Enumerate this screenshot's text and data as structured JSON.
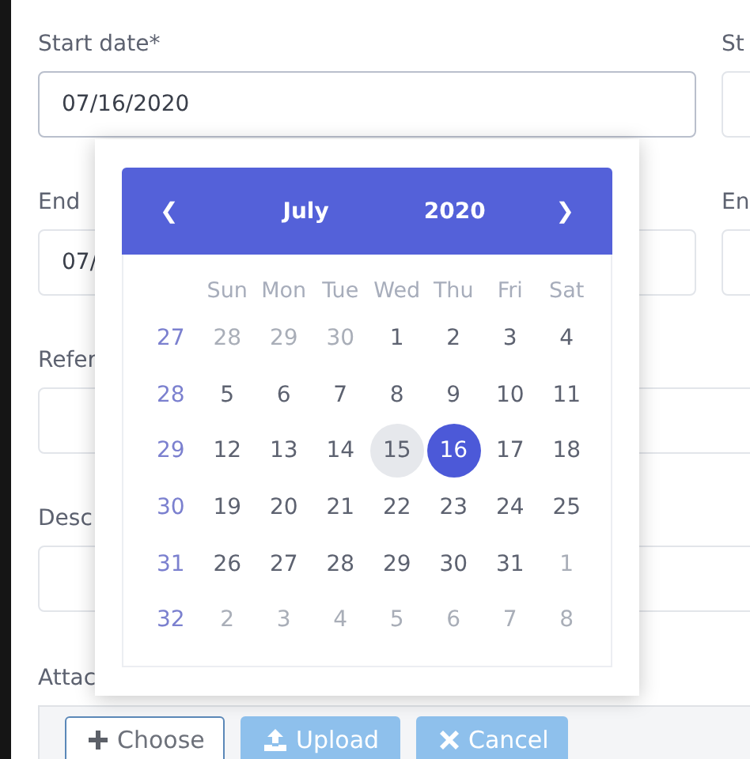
{
  "rows": [
    {
      "fields": [
        {
          "label": "Start date*",
          "value": "07/16/2020"
        },
        {
          "label": "St"
        }
      ]
    },
    {
      "fields": [
        {
          "label": "End",
          "value": "07/"
        },
        {
          "label": "En"
        }
      ]
    },
    {
      "fields": [
        {
          "label": "Refer"
        }
      ]
    },
    {
      "fields": [
        {
          "label": "Desc"
        }
      ]
    }
  ],
  "attachment": {
    "label": "Attac",
    "buttons": [
      {
        "label": "Choose",
        "kind": "choose"
      },
      {
        "label": "Upload",
        "kind": "upload"
      },
      {
        "label": "Cancel",
        "kind": "cancel"
      }
    ]
  },
  "datepicker": {
    "prev": "❮",
    "month": "July",
    "year": "2020",
    "next": "❯",
    "weekdays": [
      "Sun",
      "Mon",
      "Tue",
      "Wed",
      "Thu",
      "Fri",
      "Sat"
    ],
    "weeks": [
      {
        "number": "27",
        "days": [
          {
            "label": "28",
            "muted": true,
            "today": false,
            "selected": false
          },
          {
            "label": "29",
            "muted": true,
            "today": false,
            "selected": false
          },
          {
            "label": "30",
            "muted": true,
            "today": false,
            "selected": false
          },
          {
            "label": "1",
            "muted": false,
            "today": false,
            "selected": false
          },
          {
            "label": "2",
            "muted": false,
            "today": false,
            "selected": false
          },
          {
            "label": "3",
            "muted": false,
            "today": false,
            "selected": false
          },
          {
            "label": "4",
            "muted": false,
            "today": false,
            "selected": false
          }
        ]
      },
      {
        "number": "28",
        "days": [
          {
            "label": "5",
            "muted": false,
            "today": false,
            "selected": false
          },
          {
            "label": "6",
            "muted": false,
            "today": false,
            "selected": false
          },
          {
            "label": "7",
            "muted": false,
            "today": false,
            "selected": false
          },
          {
            "label": "8",
            "muted": false,
            "today": false,
            "selected": false
          },
          {
            "label": "9",
            "muted": false,
            "today": false,
            "selected": false
          },
          {
            "label": "10",
            "muted": false,
            "today": false,
            "selected": false
          },
          {
            "label": "11",
            "muted": false,
            "today": false,
            "selected": false
          }
        ]
      },
      {
        "number": "29",
        "days": [
          {
            "label": "12",
            "muted": false,
            "today": false,
            "selected": false
          },
          {
            "label": "13",
            "muted": false,
            "today": false,
            "selected": false
          },
          {
            "label": "14",
            "muted": false,
            "today": false,
            "selected": false
          },
          {
            "label": "15",
            "muted": false,
            "today": true,
            "selected": false
          },
          {
            "label": "16",
            "muted": false,
            "today": false,
            "selected": true
          },
          {
            "label": "17",
            "muted": false,
            "today": false,
            "selected": false
          },
          {
            "label": "18",
            "muted": false,
            "today": false,
            "selected": false
          }
        ]
      },
      {
        "number": "30",
        "days": [
          {
            "label": "19",
            "muted": false,
            "today": false,
            "selected": false
          },
          {
            "label": "20",
            "muted": false,
            "today": false,
            "selected": false
          },
          {
            "label": "21",
            "muted": false,
            "today": false,
            "selected": false
          },
          {
            "label": "22",
            "muted": false,
            "today": false,
            "selected": false
          },
          {
            "label": "23",
            "muted": false,
            "today": false,
            "selected": false
          },
          {
            "label": "24",
            "muted": false,
            "today": false,
            "selected": false
          },
          {
            "label": "25",
            "muted": false,
            "today": false,
            "selected": false
          }
        ]
      },
      {
        "number": "31",
        "days": [
          {
            "label": "26",
            "muted": false,
            "today": false,
            "selected": false
          },
          {
            "label": "27",
            "muted": false,
            "today": false,
            "selected": false
          },
          {
            "label": "28",
            "muted": false,
            "today": false,
            "selected": false
          },
          {
            "label": "29",
            "muted": false,
            "today": false,
            "selected": false
          },
          {
            "label": "30",
            "muted": false,
            "today": false,
            "selected": false
          },
          {
            "label": "31",
            "muted": false,
            "today": false,
            "selected": false
          },
          {
            "label": "1",
            "muted": true,
            "today": false,
            "selected": false
          }
        ]
      },
      {
        "number": "32",
        "days": [
          {
            "label": "2",
            "muted": true,
            "today": false,
            "selected": false
          },
          {
            "label": "3",
            "muted": true,
            "today": false,
            "selected": false
          },
          {
            "label": "4",
            "muted": true,
            "today": false,
            "selected": false
          },
          {
            "label": "5",
            "muted": true,
            "today": false,
            "selected": false
          },
          {
            "label": "6",
            "muted": true,
            "today": false,
            "selected": false
          },
          {
            "label": "7",
            "muted": true,
            "today": false,
            "selected": false
          },
          {
            "label": "8",
            "muted": true,
            "today": false,
            "selected": false
          }
        ]
      }
    ]
  }
}
